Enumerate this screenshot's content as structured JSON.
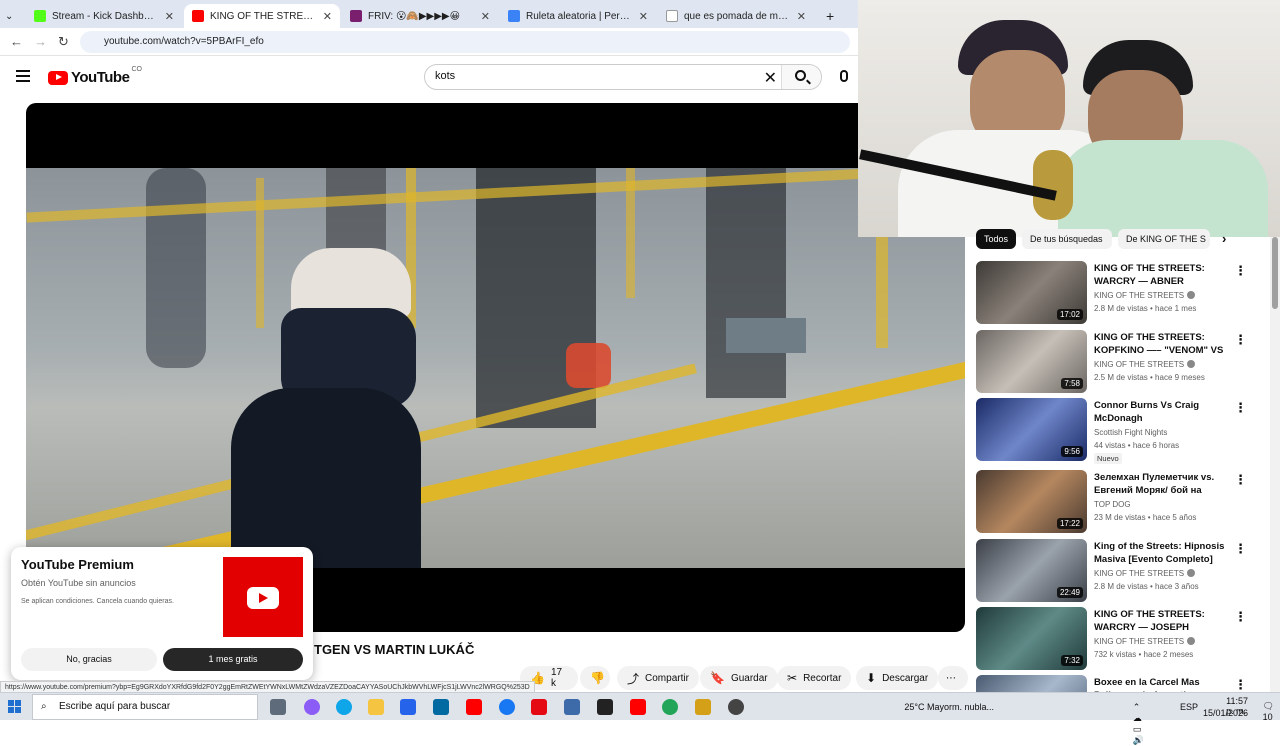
{
  "browser": {
    "tabs": [
      {
        "title": "Stream - Kick Dashboard",
        "color": "#53fc18",
        "active": false
      },
      {
        "title": "KING OF THE STREETS: WARCR",
        "color": "#ff0000",
        "active": true
      },
      {
        "title": "FRIV: 😮🙈▶▶▶▶😀",
        "color": "#7a1f6e",
        "active": false
      },
      {
        "title": "Ruleta aleatoria | Personaliza y",
        "color": "#3b82f6",
        "active": false
      },
      {
        "title": "que es pomada de marihuana",
        "color": "#ffffff",
        "active": false
      }
    ],
    "new_tab": "+",
    "url": "youtube.com/watch?v=5PBArFI_efo"
  },
  "youtube": {
    "logo": "YouTube",
    "country": "CO",
    "search_value": "kots"
  },
  "video": {
    "title": "TGEN VS MARTIN LUKÁČ",
    "actions": {
      "likes": "17 k",
      "share": "Compartir",
      "save": "Guardar",
      "clip": "Recortar",
      "download": "Descargar"
    }
  },
  "premium_popup": {
    "title": "YouTube Premium",
    "subtitle": "Obtén YouTube sin anuncios",
    "terms": "Se aplican condiciones. Cancela cuando quieras.",
    "decline": "No, gracias",
    "accept": "1 mes gratis"
  },
  "status_url": "https://www.youtube.com/premium?ybp=Eg9GRXdoYXRfdG9fd2F0Y2ggEmRtZWEtYWNxLWMtZWdzaVZEZDoaCAYYASoUChJkbWVhLWFjcS1jLWVnc2lWRGQ%253D",
  "chips": [
    {
      "label": "Todos",
      "active": true
    },
    {
      "label": "De tus búsquedas",
      "active": false
    },
    {
      "label": "De KING OF THE S",
      "active": false
    }
  ],
  "recommendations": [
    {
      "title": "KING OF THE STREETS: WARCRY — ABNER LLOVERAS...",
      "channel": "KING OF THE STREETS",
      "verified": true,
      "meta": "2.8 M de vistas • hace 1 mes",
      "duration": "17:02",
      "badge": "",
      "colors": [
        "#3d3a36",
        "#8a8179"
      ]
    },
    {
      "title": "KING OF THE STREETS: KOPFKINO —– \"VENOM\" VS ...",
      "channel": "KING OF THE STREETS",
      "verified": true,
      "meta": "2.5 M de vistas • hace 9 meses",
      "duration": "7:58",
      "badge": "",
      "colors": [
        "#6b6662",
        "#c6bfb7"
      ]
    },
    {
      "title": "Connor Burns Vs Craig McDonagh",
      "channel": "Scottish Fight Nights",
      "verified": false,
      "meta": "44 vistas • hace 6 horas",
      "duration": "9:56",
      "badge": "Nuevo",
      "colors": [
        "#1a2a66",
        "#6f86c9"
      ]
    },
    {
      "title": "Зелемхан Пулеметчик vs. Евгений Моряк/ бой на голы...",
      "channel": "TOP DOG",
      "verified": false,
      "meta": "23 M de vistas • hace 5 años",
      "duration": "17:22",
      "badge": "",
      "colors": [
        "#4a3a30",
        "#b5875f"
      ]
    },
    {
      "title": "King of the Streets: Hipnosis Masiva [Evento Completo]",
      "channel": "KING OF THE STREETS",
      "verified": true,
      "meta": "2.8 M de vistas • hace 3 años",
      "duration": "22:49",
      "badge": "",
      "colors": [
        "#3b4048",
        "#9aa2ab"
      ]
    },
    {
      "title": "KING OF THE STREETS: WARCRY — JOSEPH HAPGOO...",
      "channel": "KING OF THE STREETS",
      "verified": true,
      "meta": "732 k vistas • hace 2 meses",
      "duration": "7:32",
      "badge": "",
      "colors": [
        "#1f3a3a",
        "#5e8a86"
      ]
    },
    {
      "title": "Boxee en la Carcel Mas Peligrosa de Argentina",
      "channel": "",
      "verified": false,
      "meta": "",
      "duration": "",
      "badge": "",
      "colors": [
        "#4a5a70",
        "#a8b8cc"
      ]
    }
  ],
  "taskbar": {
    "search_placeholder": "Escribe aquí para buscar",
    "weather": "25°C  Mayorm. nubla...",
    "lang": "ESP",
    "time": "11:57 p. m.",
    "date": "15/01/2026",
    "notifications": "10"
  }
}
